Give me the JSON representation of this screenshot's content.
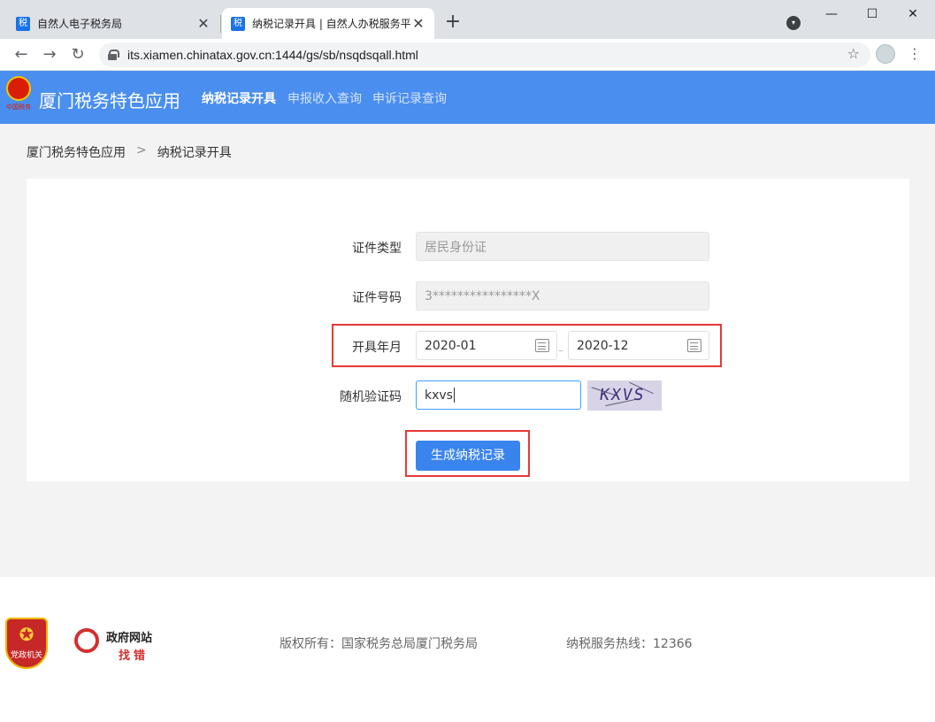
{
  "browser": {
    "tabs": [
      {
        "title": "自然人电子税务局",
        "favicon": "税"
      },
      {
        "title": "纳税记录开具 | 自然人办税服务平",
        "favicon": "税"
      }
    ],
    "new_tab": "+",
    "url": "its.xiamen.chinatax.gov.cn:1444/gs/sb/nsqdsqall.html",
    "window_controls": [
      "—",
      "☐",
      "✕"
    ]
  },
  "header": {
    "emblem_caption": "中国税务",
    "title": "厦门税务特色应用",
    "nav": [
      "纳税记录开具",
      "申报收入查询",
      "申诉记录查询"
    ]
  },
  "breadcrumb": [
    "厦门税务特色应用",
    "纳税记录开具"
  ],
  "breadcrumb_sep": ">",
  "form": {
    "id_type": {
      "label": "证件类型",
      "value": "居民身份证"
    },
    "id_number": {
      "label": "证件号码",
      "value": "3****************X"
    },
    "period": {
      "label": "开具年月",
      "start": "2020-01",
      "end": "2020-12",
      "separator": "–"
    },
    "captcha": {
      "label": "随机验证码",
      "value": "kxvs",
      "image_text": "KXVS"
    },
    "submit_label": "生成纳税记录"
  },
  "footer": {
    "badge_text": "党政机关",
    "gov_line1": "政府网站",
    "gov_line2": "找错",
    "copyright": "版权所有：国家税务总局厦门税务局",
    "hotline": "纳税服务热线：12366"
  },
  "colors": {
    "header_bg": "#4a8eef",
    "primary": "#3a84ee",
    "highlight": "#e53935"
  }
}
